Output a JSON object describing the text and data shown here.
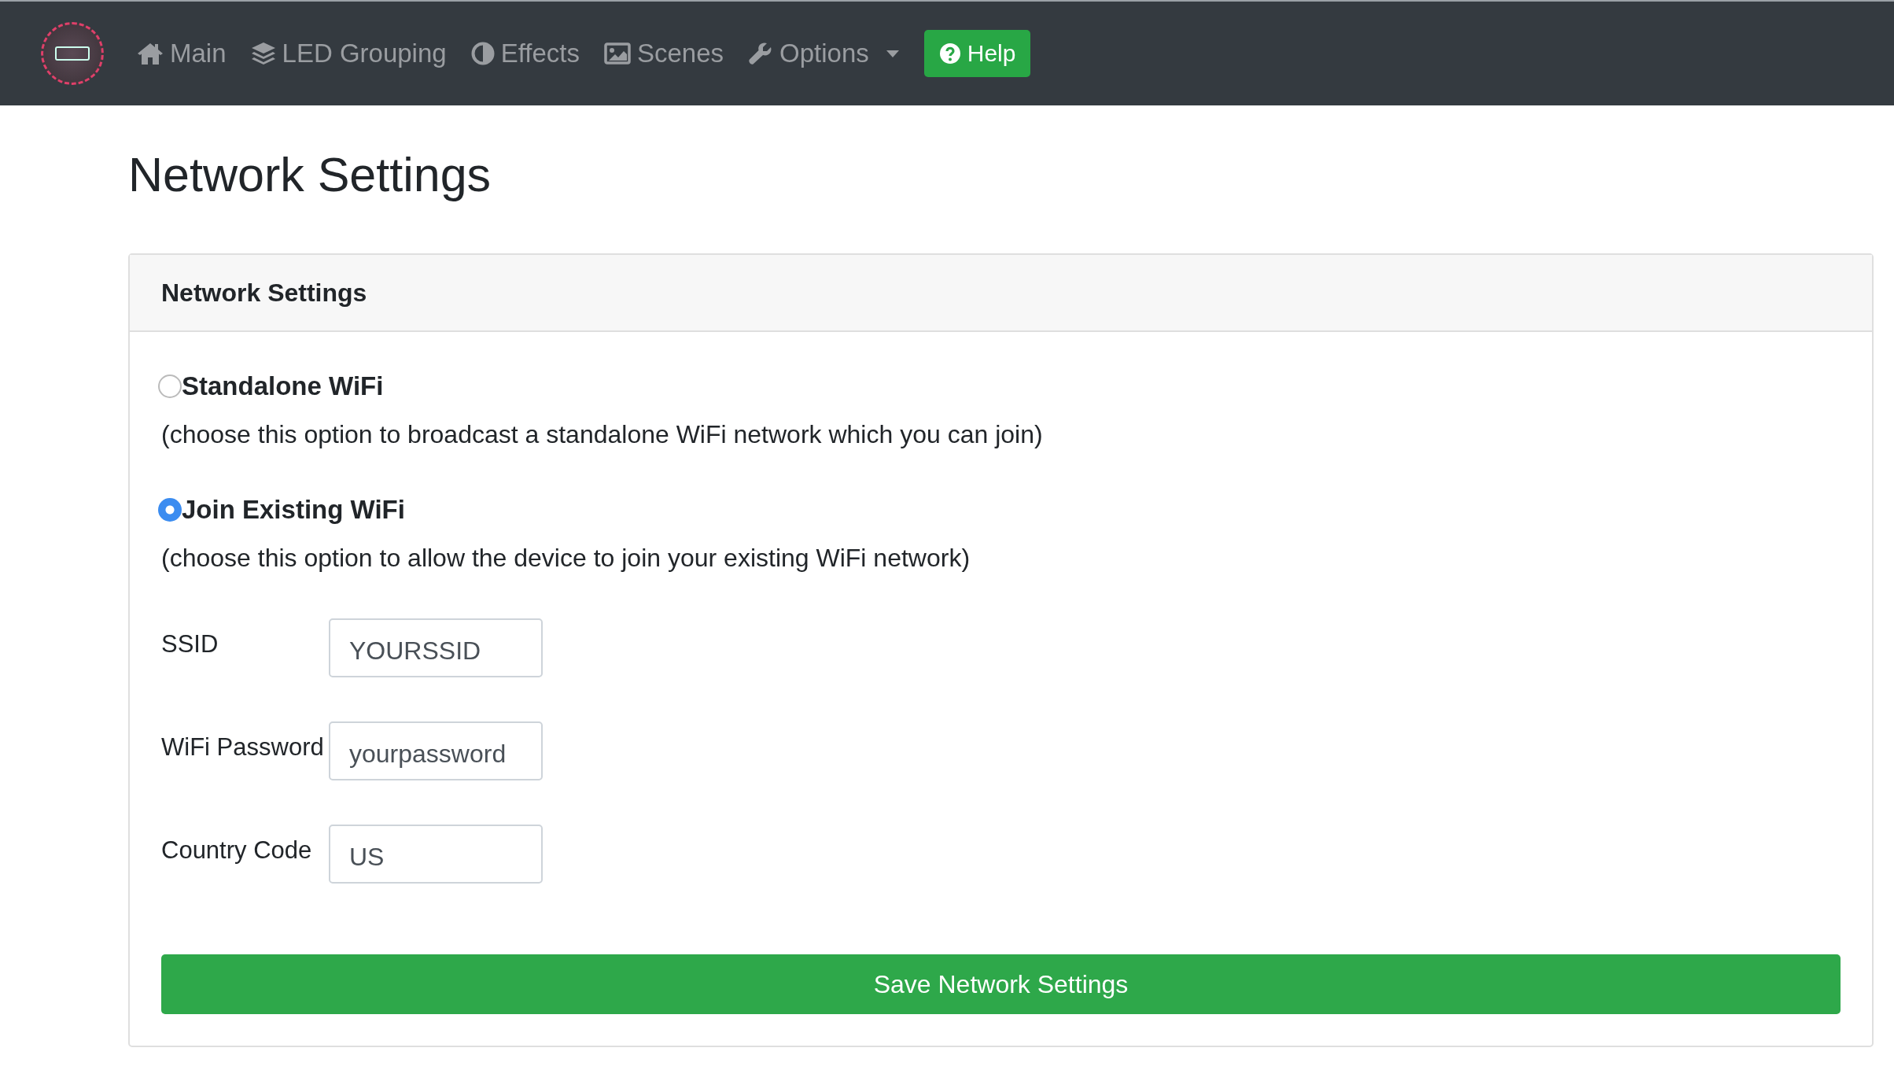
{
  "navbar": {
    "items": [
      {
        "kind": "home",
        "label": "Main",
        "dropdown": false
      },
      {
        "kind": "layers",
        "label": "LED Grouping",
        "dropdown": false
      },
      {
        "kind": "contrast",
        "label": "Effects",
        "dropdown": false
      },
      {
        "kind": "image",
        "label": "Scenes",
        "dropdown": false
      },
      {
        "kind": "wrench",
        "label": "Options",
        "dropdown": true
      }
    ],
    "help_button": "Help"
  },
  "page_title": "Network Settings",
  "card": {
    "title": "Network Settings",
    "options": [
      {
        "label": "Standalone WiFi",
        "description": "(choose this option to broadcast a standalone WiFi network which you can join)",
        "selected": false
      },
      {
        "label": "Join Existing WiFi",
        "description": "(choose this option to allow the device to join your existing WiFi network)",
        "selected": true
      }
    ],
    "fields": [
      {
        "label": "SSID",
        "value": "YOURSSID"
      },
      {
        "label": "WiFi Password",
        "value": "yourpassword"
      },
      {
        "label": "Country Code",
        "value": "US"
      }
    ],
    "save_button": "Save Network Settings"
  }
}
